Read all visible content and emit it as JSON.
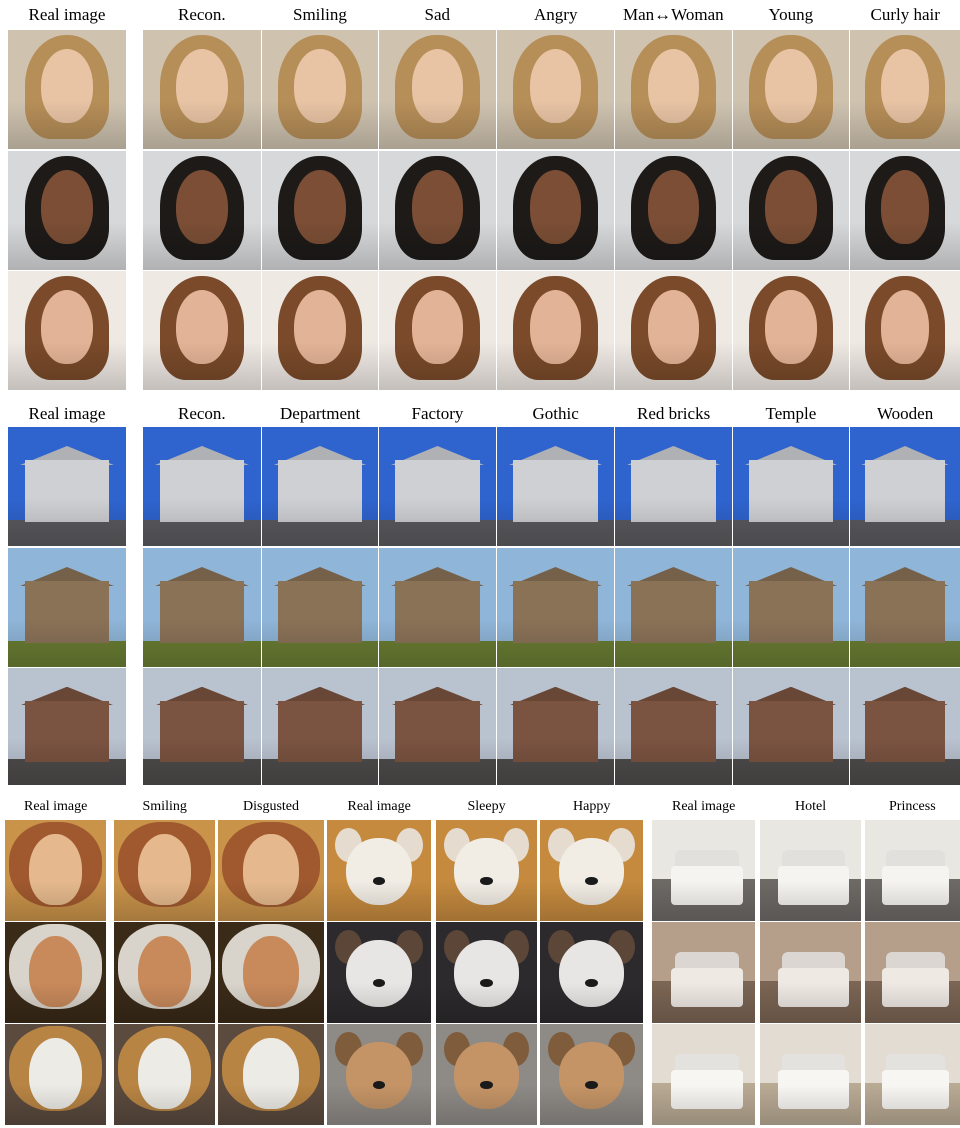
{
  "figure": {
    "face_block": {
      "headers": [
        "Real image",
        "Recon.",
        "Smiling",
        "Sad",
        "Angry",
        "Man↔Woman",
        "Young",
        "Curly hair"
      ],
      "rows": [
        {
          "palette": {
            "bg": "#cfc3b0",
            "skin": "#e8c3a4",
            "hair": "#b68e58"
          }
        },
        {
          "palette": {
            "bg": "#d7d8da",
            "skin": "#7b4e35",
            "hair": "#1d1a18"
          }
        },
        {
          "palette": {
            "bg": "#efe9e4",
            "skin": "#e2b396",
            "hair": "#7a4a2a"
          }
        }
      ]
    },
    "church_block": {
      "headers": [
        "Real image",
        "Recon.",
        "Department",
        "Factory",
        "Gothic",
        "Red bricks",
        "Temple",
        "Wooden"
      ],
      "rows": [
        {
          "palette": {
            "sky": "#2f64cf",
            "ground": "#5b5a5e",
            "building": "#cfd0d4"
          }
        },
        {
          "palette": {
            "sky": "#8fb5d8",
            "ground": "#6a7d33",
            "building": "#8a7257"
          }
        },
        {
          "palette": {
            "sky": "#b9c2cf",
            "ground": "#4e4b4b",
            "building": "#7b5341"
          }
        }
      ]
    },
    "extra_block": {
      "art": {
        "headers": [
          "Real image",
          "Smiling",
          "Disgusted"
        ],
        "rows": [
          {
            "palette": {
              "bg": "#c9934a",
              "skin": "#e5b98d",
              "hair": "#a0592f"
            }
          },
          {
            "palette": {
              "bg": "#3a2a18",
              "skin": "#c8895b",
              "hair": "#d9d4cb"
            }
          },
          {
            "palette": {
              "bg": "#5b4a3e",
              "skin": "#ecebe6",
              "hair": "#b88443"
            }
          }
        ]
      },
      "dogs": {
        "headers": [
          "Real image",
          "Sleepy",
          "Happy"
        ],
        "rows": [
          {
            "palette": {
              "bg": "#c58a3e",
              "fur": "#f1ece4",
              "ear": "#e5dbcf"
            }
          },
          {
            "palette": {
              "bg": "#2c2a2c",
              "fur": "#e8e6e4",
              "ear": "#5c4638"
            }
          },
          {
            "palette": {
              "bg": "#8e8a86",
              "fur": "#c49466",
              "ear": "#7e5c3c"
            }
          }
        ]
      },
      "bedrooms": {
        "headers": [
          "Real image",
          "Hotel",
          "Princess"
        ],
        "rows": [
          {
            "palette": {
              "wall": "#e9e7e2",
              "floor": "#6d6a66",
              "bed": "#f6f4f0"
            }
          },
          {
            "palette": {
              "wall": "#b59e8a",
              "floor": "#7b6554",
              "bed": "#efe9e4"
            }
          },
          {
            "palette": {
              "wall": "#e2dcd2",
              "floor": "#b9aa94",
              "bed": "#f8f6f2"
            }
          }
        ]
      }
    }
  }
}
